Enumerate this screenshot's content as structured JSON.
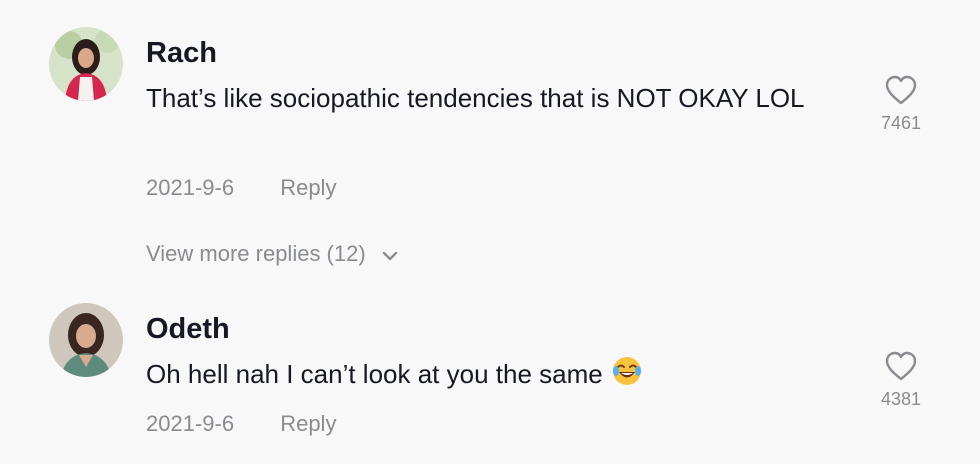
{
  "comments": [
    {
      "author": "Rach",
      "text": "That’s like sociopathic tendencies that is NOT OKAY LOL",
      "date": "2021-9-6",
      "reply_label": "Reply",
      "likes": "7461"
    },
    {
      "author": "Odeth",
      "text": "Oh hell nah I can’t look at you the same",
      "emoji": "face-with-tears-of-joy-icon",
      "date": "2021-9-6",
      "reply_label": "Reply",
      "likes": "4381"
    }
  ],
  "view_more": {
    "label": "View more replies (12)",
    "icon": "chevron-down-icon"
  },
  "colors": {
    "background": "#f8f8f8",
    "text_primary": "#161823",
    "text_secondary": "#8a8b91"
  }
}
